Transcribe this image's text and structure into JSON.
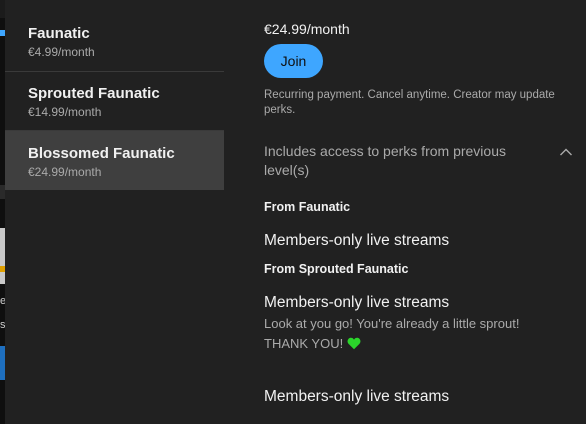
{
  "tiers": [
    {
      "name": "Faunatic",
      "price": "€4.99/month",
      "selected": false
    },
    {
      "name": "Sprouted Faunatic",
      "price": "€14.99/month",
      "selected": false
    },
    {
      "name": "Blossomed Faunatic",
      "price": "€24.99/month",
      "selected": true
    }
  ],
  "detail": {
    "price": "€24.99/month",
    "join_label": "Join",
    "disclaimer": "Recurring payment. Cancel anytime. Creator may update perks.",
    "perks_header": "Includes access to perks from previous level(s)",
    "sections": [
      {
        "title": "From Faunatic",
        "perks": [
          {
            "title": "Members-only live streams"
          }
        ]
      },
      {
        "title": "From Sprouted Faunatic",
        "perks": [
          {
            "title": "Members-only live streams",
            "desc": "Look at you go! You're already a little sprout! THANK YOU!"
          }
        ]
      }
    ],
    "own_perk_title": "Members-only live streams"
  },
  "background": {
    "left_letters": [
      "e",
      "s"
    ]
  },
  "colors": {
    "accent": "#3ea6ff",
    "heart": "#2bd52b",
    "panel": "#212121",
    "selected": "#3f3f3f"
  },
  "icons": {
    "perks_toggle": "chevron-up-icon",
    "heart": "green-heart-icon"
  }
}
